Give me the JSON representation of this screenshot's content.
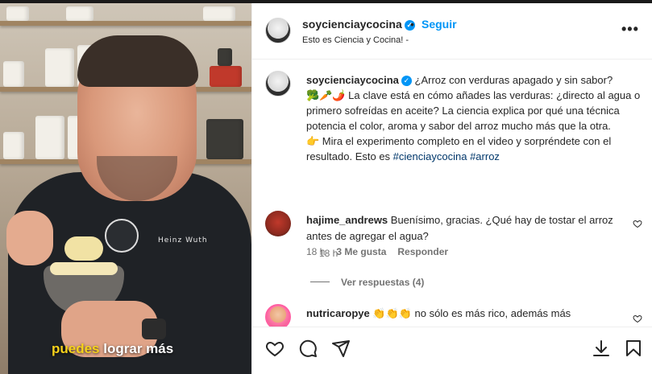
{
  "video": {
    "jacket_name": "Heinz Wuth",
    "caption_highlight": "puedes",
    "caption_rest": " lograr más"
  },
  "header": {
    "username": "soycienciaycocina",
    "dot": "•",
    "follow_label": "Seguir",
    "subtitle": "Esto es Ciencia y Cocina! -",
    "more_icon": "more-horizontal-icon",
    "verified_icon": "verified-badge-icon"
  },
  "post": {
    "username": "soycienciaycocina",
    "line1": " ¿Arroz con verduras apagado y sin sabor?",
    "para1": "🥦🥕🌶️ La clave está en cómo añades las verduras: ¿directo al agua o primero sofreídas en aceite? La ciencia explica por qué una técnica potencia el color, aroma y sabor del arroz mucho más que la otra.",
    "para2": "👉 Mira el experimento completo en el video y sorpréndete con el resultado. Esto es ",
    "tag1": "#cienciaycocina",
    "tag2": "#arroz",
    "time": "18 h"
  },
  "comments": [
    {
      "username": "hajime_andrews",
      "text": " Buenísimo, gracias. ¿Qué hay de tostar el arroz antes de agregar el agua?",
      "time": "18 h",
      "likes": "3 Me gusta",
      "reply_label": "Responder",
      "view_replies": "Ver respuestas (4)"
    },
    {
      "username": "nutricaropye",
      "text": " 👏👏👏 no sólo es más rico, además más"
    }
  ],
  "actions": {
    "like_icon": "heart-icon",
    "comment_icon": "comment-icon",
    "share_icon": "send-icon",
    "download_icon": "download-icon",
    "save_icon": "bookmark-icon"
  },
  "colors": {
    "accent": "#0095f6",
    "muted": "#737373",
    "hashtag": "#00376b",
    "caption_highlight": "#f6d21b"
  }
}
